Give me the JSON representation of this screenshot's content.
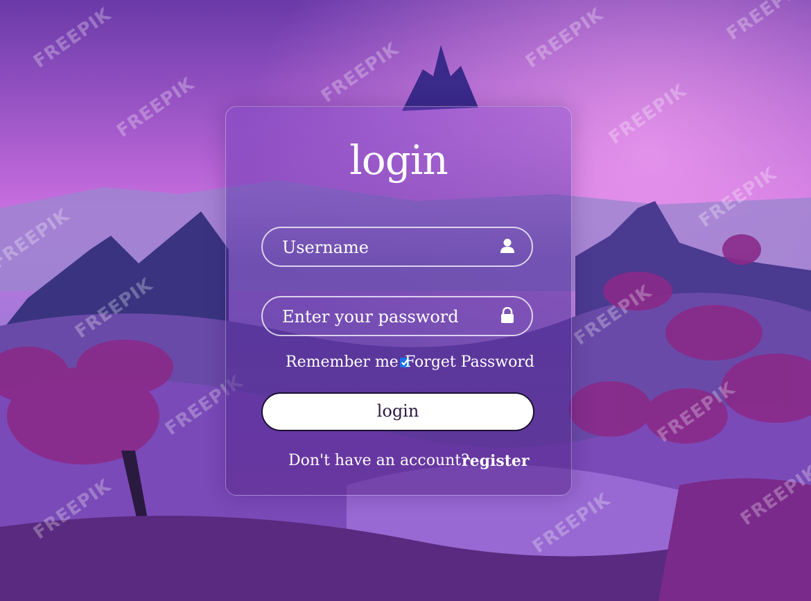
{
  "background": {
    "watermark_text": "FREEPIK",
    "colors": {
      "sky_top": "#6a3aa8",
      "sky_glow": "#e07ee8",
      "foliage": "#8a2a8a",
      "ground": "#3a2060"
    }
  },
  "login_card": {
    "title": "login",
    "username": {
      "placeholder": "Username",
      "icon": "user-icon"
    },
    "password": {
      "placeholder": "Enter your password",
      "icon": "lock-icon"
    },
    "remember_label": "Remember me",
    "remember_checked": true,
    "forgot_label": "Forget Password",
    "submit_label": "login",
    "no_account_text": "Don't have an account?",
    "register_label": "register"
  }
}
